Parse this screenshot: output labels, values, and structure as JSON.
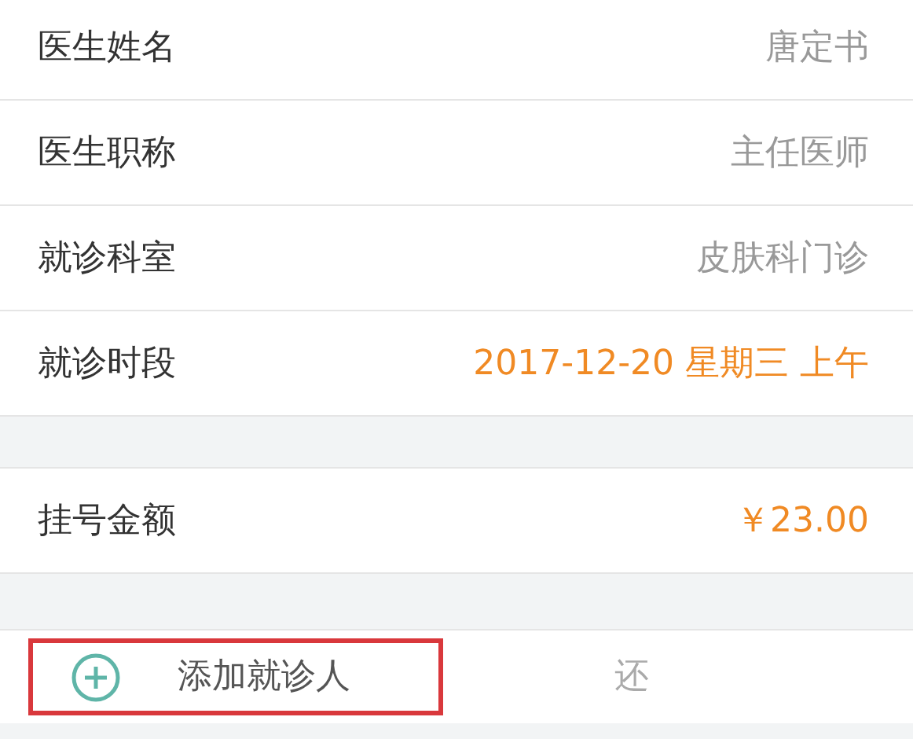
{
  "info_rows": [
    {
      "label": "医生姓名",
      "value": "唐定书",
      "highlight": false
    },
    {
      "label": "医生职称",
      "value": "主任医师",
      "highlight": false
    },
    {
      "label": "就诊科室",
      "value": "皮肤科门诊",
      "highlight": false
    },
    {
      "label": "就诊时段",
      "value": "2017-12-20 星期三 上午",
      "highlight": true
    }
  ],
  "fee_row": {
    "label": "挂号金额",
    "value": "￥23.00"
  },
  "add_patient": {
    "label": "添加就诊人",
    "highlighted": true,
    "note": "还"
  }
}
